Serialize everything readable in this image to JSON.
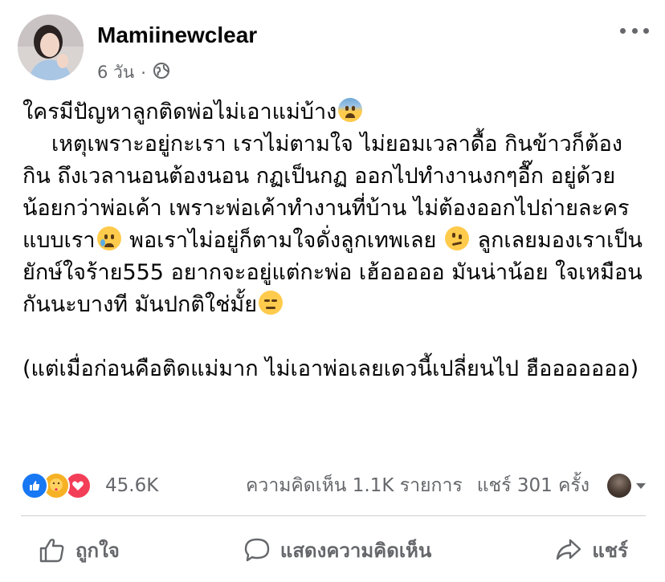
{
  "post": {
    "author": "Mamiinewclear",
    "time": "6 วัน",
    "separator": "·",
    "privacy_icon": "globe-icon",
    "more_icon": "more-options-icon",
    "body": {
      "line1": "ใครมีปัญหาลูกติดพ่อไม่เอาแม่บ้าง",
      "line1_emoji": "fearful-face",
      "para2_part1": "เหตุเพราะอยู่กะเรา เราไม่ตามใจ ไม่ยอมเวลาดื้อ กินข้าวก็ต้องกิน ถึงเวลานอนต้องนอน กฏเป็นกฏ ออกไปทำงานงกๆอื๊ก อยู่ด้วยน้อยกว่าพ่อเค้า เพราะพ่อเค้าทำงานที่บ้าน ไม่ต้องออกไปถ่ายละครแบบเรา",
      "para2_emoji1": "crying-face",
      "para2_part2": " พอเราไม่อยู่ก็ตามใจดั่งลูกเทพเลย ",
      "para2_emoji2": "raised-eyebrow-face",
      "para2_part3": " ลูกเลยมองเราเป็นยักษ์ใจร้าย555 อยากจะอยู่แต่กะพ่อ เฮ้อออออ มันน่าน้อย ใจเหมือนกันนะบางที มันปกติใช่มั้ย",
      "para2_emoji3": "expressionless-face",
      "para3": "(แต่เมื่อก่อนคือติดแม่มาก ไม่เอาพ่อเลยเดวนี้เปลี่ยนไป ฮือออออออ)"
    }
  },
  "reactions": {
    "icons": [
      "like-reaction-icon",
      "care-reaction-icon",
      "love-reaction-icon"
    ],
    "count": "45.6K",
    "comments": "ความคิดเห็น 1.1K รายการ",
    "shares": "แชร์ 301 ครั้ง"
  },
  "actions": {
    "like_label": "ถูกใจ",
    "comment_label": "แสดงความคิดเห็น",
    "share_label": "แชร์"
  },
  "colors": {
    "secondary_text": "#65676b",
    "like_blue": "#1877f2",
    "love_red": "#f33e58",
    "care_yellow": "#f7b125",
    "divider": "#ced0d4"
  }
}
